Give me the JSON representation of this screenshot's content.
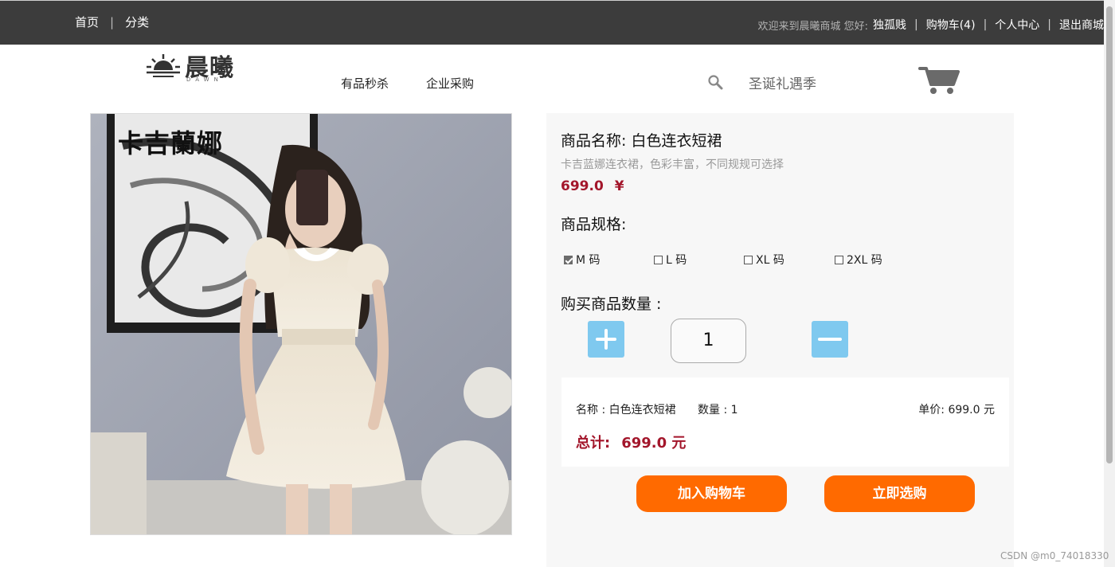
{
  "topbar": {
    "nav": [
      "首页",
      "分类"
    ],
    "welcome": "欢迎来到晨曦商城 您好:",
    "username": "独孤贱",
    "cart": "购物车(4)",
    "profile": "个人中心",
    "logout": "退出商城"
  },
  "header": {
    "logo_text": "晨曦",
    "logo_sub": "DAWN",
    "nav_items": [
      "有品秒杀",
      "企业采购"
    ],
    "search_value": "圣诞礼遇季",
    "icons": [
      "search-icon",
      "cart-icon"
    ]
  },
  "product": {
    "image_brand_text": "卡吉蘭娜",
    "name": "商品名称: 白色连衣短裙",
    "description": "卡吉蓝娜连衣裙，色彩丰富，不同规规可选择",
    "price": "699.0",
    "currency": "¥",
    "spec_title": "商品规格:",
    "specs": [
      {
        "label": "M 码",
        "checked": true
      },
      {
        "label": "L 码",
        "checked": false
      },
      {
        "label": "XL 码",
        "checked": false
      },
      {
        "label": "2XL 码",
        "checked": false
      }
    ],
    "quantity_title": "购买商品数量 :",
    "quantity": "1"
  },
  "summary": {
    "name": "名称 : 白色连衣短裙",
    "quantity": "数量 : 1",
    "unit_price": "单价: 699.0 元",
    "total_label": "总计:",
    "total_value": "699.0 元"
  },
  "actions": {
    "add_to_cart": "加入购物车",
    "buy_now": "立即选购"
  },
  "watermark": "CSDN @m0_74018330",
  "colors": {
    "topbar_bg": "#3c3c3c",
    "price_red": "#a3162b",
    "button_orange": "#ff6a00",
    "qty_button_blue": "#7fc9ef"
  }
}
